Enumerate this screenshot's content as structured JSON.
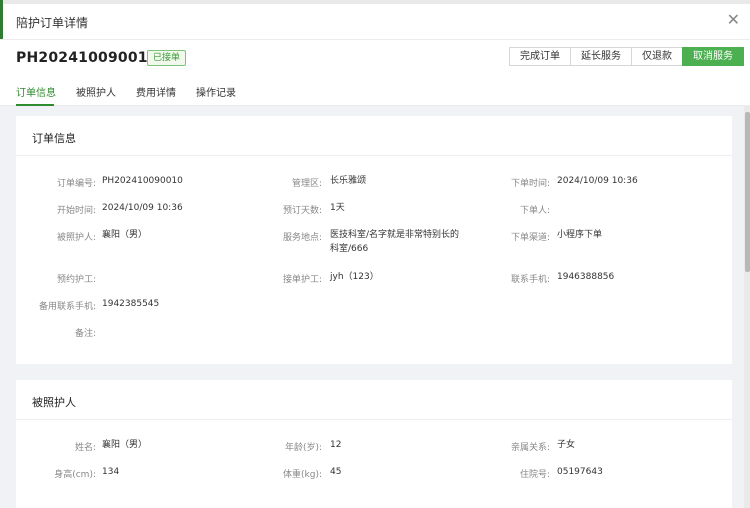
{
  "dialog": {
    "title": "陪护订单详情",
    "close_icon": "close-icon"
  },
  "order": {
    "number": "PH202410090010",
    "status_badge": "已接单"
  },
  "actions": {
    "complete": "完成订单",
    "extend": "延长服务",
    "refund_only": "仅退款",
    "cancel": "取消服务"
  },
  "tabs": [
    "订单信息",
    "被照护人",
    "费用详情",
    "操作记录"
  ],
  "colors": {
    "accent": "#4caf50",
    "active_tab": "#2e8b2e",
    "badge_bg": "#f0f9eb"
  },
  "order_info": {
    "title": "订单信息",
    "fields": {
      "order_no": {
        "label": "订单编号:",
        "value": "PH202410090010"
      },
      "area": {
        "label": "管理区:",
        "value": "长乐雅颂"
      },
      "created_time": {
        "label": "下单时间:",
        "value": "2024/10/09 10:36"
      },
      "start_time": {
        "label": "开始时间:",
        "value": "2024/10/09 10:36"
      },
      "days": {
        "label": "预订天数:",
        "value": "1天"
      },
      "creator": {
        "label": "下单人:",
        "value": ""
      },
      "patient": {
        "label": "被照护人:",
        "value": "襄阳（男）"
      },
      "location": {
        "label": "服务地点:",
        "value": "医技科室/名字就是非常特别长的科室/666"
      },
      "channel": {
        "label": "下单渠道:",
        "value": "小程序下单"
      },
      "booked_nurse": {
        "label": "预约护工:",
        "value": ""
      },
      "accepted_nurse": {
        "label": "接单护工:",
        "value": "jyh（123）"
      },
      "phone": {
        "label": "联系手机:",
        "value": "1946388856"
      },
      "backup_phone": {
        "label": "备用联系手机:",
        "value": "1942385545"
      },
      "remark": {
        "label": "备注:",
        "value": ""
      }
    }
  },
  "patient_info": {
    "title": "被照护人",
    "fields": {
      "name": {
        "label": "姓名:",
        "value": "襄阳（男）"
      },
      "age": {
        "label": "年龄(岁):",
        "value": "12"
      },
      "relation": {
        "label": "亲属关系:",
        "value": "子女"
      },
      "height": {
        "label": "身高(cm):",
        "value": "134"
      },
      "weight": {
        "label": "体重(kg):",
        "value": "45"
      },
      "admission_no": {
        "label": "住院号:",
        "value": "05197643"
      }
    }
  }
}
